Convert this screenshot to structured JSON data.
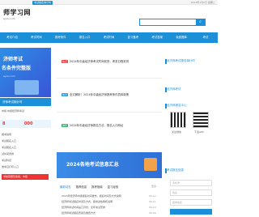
{
  "header": {
    "logo_text": "师学习网",
    "logo_sub": "eyou.com",
    "top_badge": "考试报名倒计时",
    "top_right": "2024年1月2日 星期二",
    "search_icon": "search-icon"
  },
  "nav": {
    "items": [
      "考试介绍",
      "考试时间",
      "报考条件",
      "报名入口",
      "考试时间",
      "复习备考",
      "考试答案",
      "免费题库",
      "考试"
    ]
  },
  "banner": {
    "line1": "济师考试",
    "line2": "名条件完整版",
    "line3": "eyou.com"
  },
  "left": {
    "card_title": "济师考试倒计时",
    "row1": "中级    中级经济师考试",
    "date1": "8",
    "date2": "000",
    "row2": "报考指南",
    "row3": "考试报名入口",
    "row4": "考试报名入口",
    "row5": "试时间安排",
    "row6": "考试科目",
    "row7": "准考证打印入口",
    "red_button": "考前真题及答案，中级"
  },
  "news": [
    {
      "tag": "热点",
      "tag_color": "red",
      "text": "2024年中级经济师考试时间安排，考务日程安排",
      "time": ""
    },
    {
      "tag": "快讯",
      "tag_color": "blue",
      "text": "全文解析！2024年中级经济师报考条件具体政策",
      "time": ""
    },
    {
      "tag": "推荐",
      "tag_color": "green",
      "text": "2024年中级经济师报名方法，报名入口网址",
      "time": ""
    }
  ],
  "big_banner": {
    "text": "2024各地考试信息汇总"
  },
  "tabs": {
    "items": [
      "最新动态",
      "推荐信息",
      "报考指南",
      "复习经验"
    ],
    "more": "更多"
  },
  "list": [
    {
      "text": "2024年经济师中级报名时间发布，报名时间及方式说明",
      "time": "06-12"
    },
    {
      "text": "经济师考试报名时间及方式，报考资格审核说明",
      "time": "06-11"
    },
    {
      "text": "经济师考试时间是几月份，全年考试安排",
      "time": "06-10"
    },
    {
      "text": "经济师考试报名费用及缴费方式",
      "time": "06-09"
    }
  ],
  "right": {
    "head1": "经济师考试报名倒计时",
    "head2": "经济师考试",
    "head3": "经济师报名中心",
    "qr_label1": "关注微信",
    "qr_label2": "下载APP",
    "head4": "考试报名信息",
    "input1": "手机号",
    "input2": "姓名",
    "input3": "报考地区"
  }
}
